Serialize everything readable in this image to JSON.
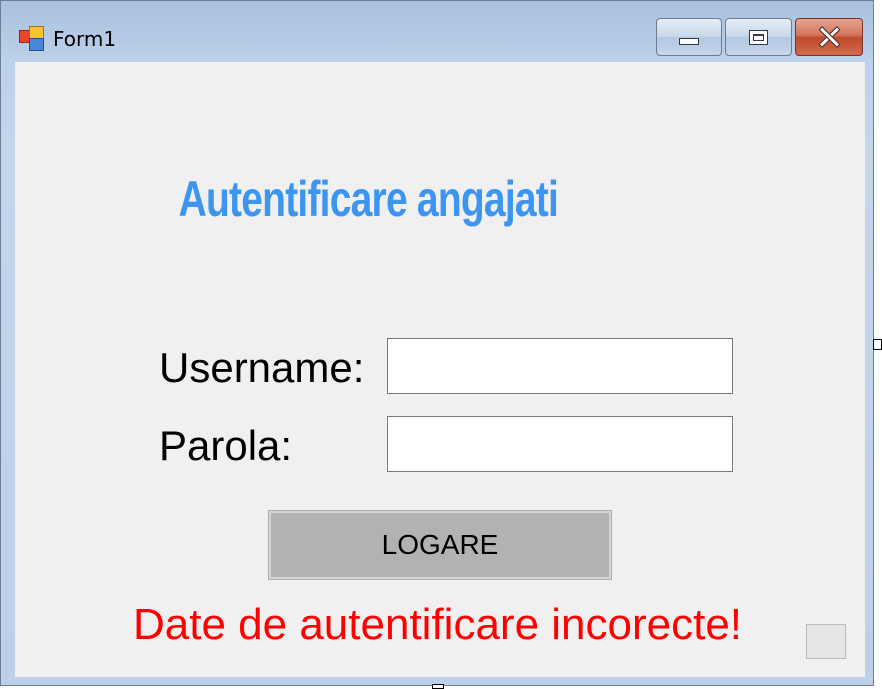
{
  "window": {
    "title": "Form1",
    "app_icon": "winforms-form-icon",
    "controls": {
      "minimize_icon": "minimize-icon",
      "maximize_icon": "maximize-icon",
      "close_icon": "close-icon"
    }
  },
  "form": {
    "heading": "Autentificare angajati",
    "username_label": "Username:",
    "username_value": "",
    "password_label": "Parola:",
    "password_value": "",
    "login_button": "LOGARE",
    "error_message": "Date de autentificare incorecte!"
  },
  "colors": {
    "heading": "#3d95f2",
    "error": "#ff0000",
    "client_background": "#f0f0f0",
    "button_background": "#b2b2b2"
  }
}
